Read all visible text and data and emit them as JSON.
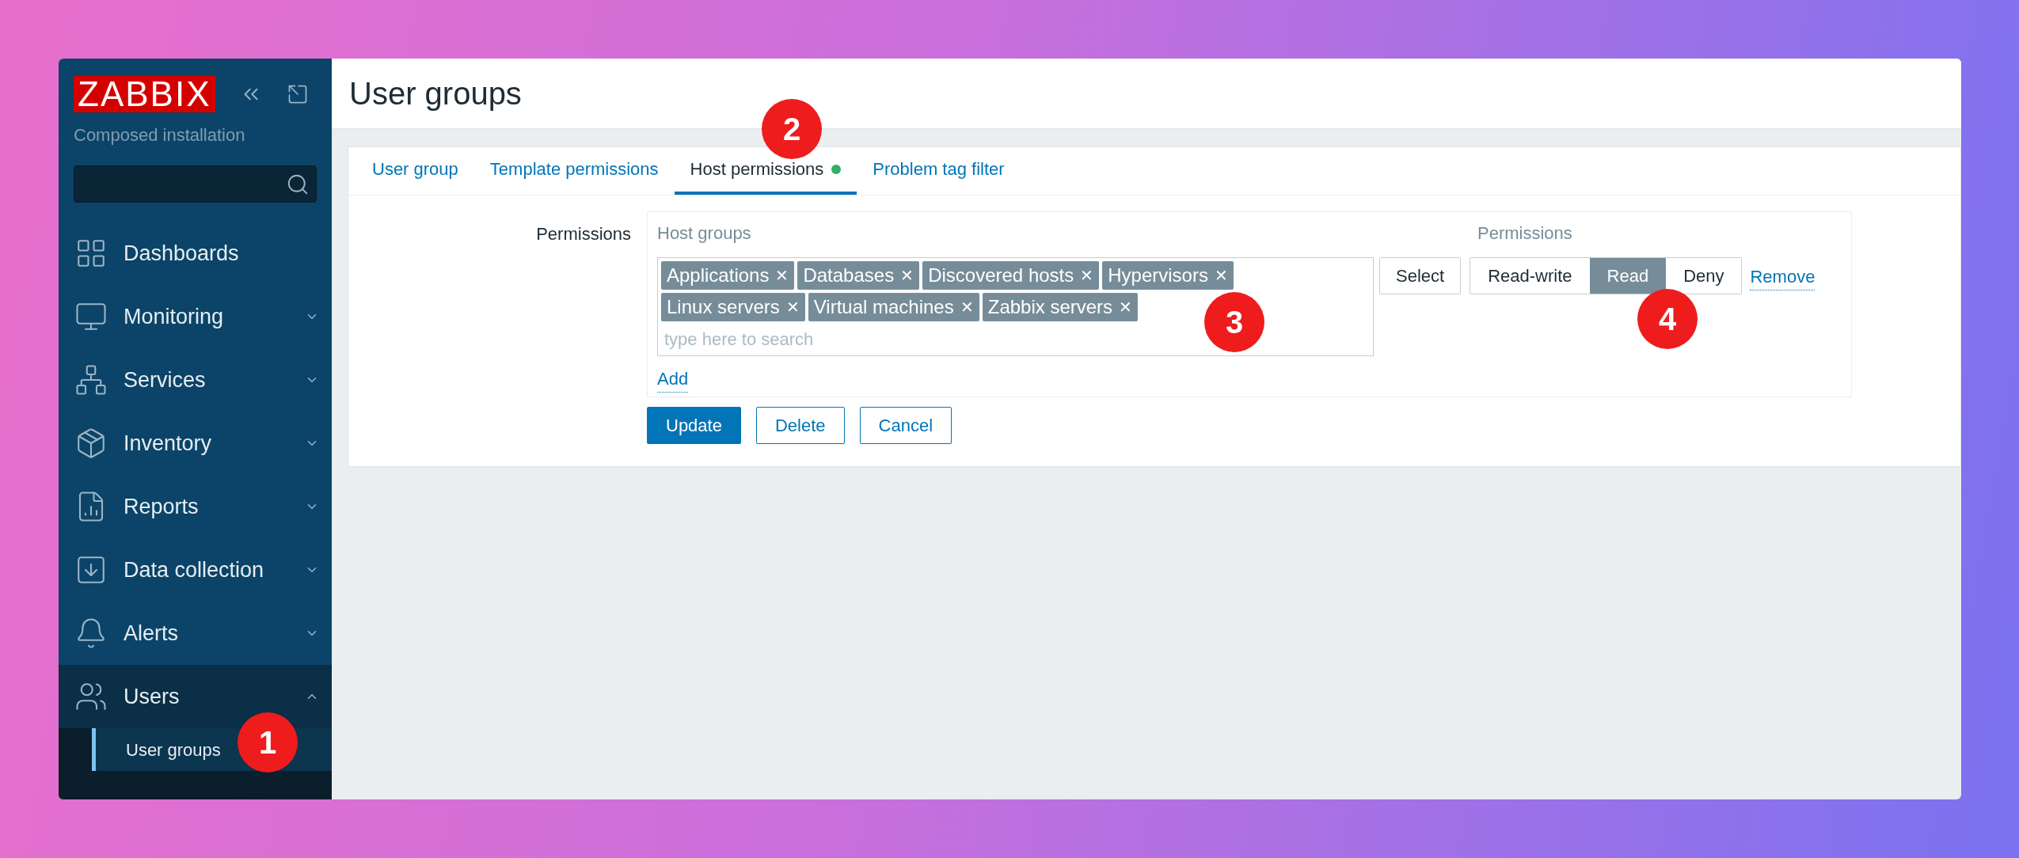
{
  "logo": "ZABBIX",
  "subtitle": "Composed installation",
  "sidebar": {
    "items": [
      {
        "label": "Dashboards",
        "kind": "link"
      },
      {
        "label": "Monitoring",
        "kind": "group",
        "expanded": false
      },
      {
        "label": "Services",
        "kind": "group",
        "expanded": false
      },
      {
        "label": "Inventory",
        "kind": "group",
        "expanded": false
      },
      {
        "label": "Reports",
        "kind": "group",
        "expanded": false
      },
      {
        "label": "Data collection",
        "kind": "group",
        "expanded": false
      },
      {
        "label": "Alerts",
        "kind": "group",
        "expanded": false
      },
      {
        "label": "Users",
        "kind": "group",
        "expanded": true,
        "children": [
          {
            "label": "User groups",
            "selected": true
          }
        ]
      }
    ]
  },
  "page_title": "User groups",
  "tabs": [
    {
      "label": "User group",
      "selected": false,
      "indicator": false
    },
    {
      "label": "Template permissions",
      "selected": false,
      "indicator": false
    },
    {
      "label": "Host permissions",
      "selected": true,
      "indicator": true
    },
    {
      "label": "Problem tag filter",
      "selected": false,
      "indicator": false
    }
  ],
  "form": {
    "label": "Permissions",
    "columns": [
      "Host groups",
      "Permissions"
    ],
    "tags": [
      "Applications",
      "Databases",
      "Discovered hosts",
      "Hypervisors",
      "Linux servers",
      "Virtual machines",
      "Zabbix servers"
    ],
    "tag_remove": "✕",
    "placeholder": "type here to search",
    "select_button": "Select",
    "permissions": [
      {
        "label": "Read-write",
        "selected": false
      },
      {
        "label": "Read",
        "selected": true
      },
      {
        "label": "Deny",
        "selected": false
      }
    ],
    "remove_link": "Remove",
    "add_link": "Add",
    "actions": [
      {
        "label": "Update",
        "kind": "primary"
      },
      {
        "label": "Delete",
        "kind": "secondary"
      },
      {
        "label": "Cancel",
        "kind": "secondary"
      }
    ]
  },
  "annotations": [
    {
      "label": "1"
    },
    {
      "label": "2"
    },
    {
      "label": "3"
    },
    {
      "label": "4"
    }
  ]
}
